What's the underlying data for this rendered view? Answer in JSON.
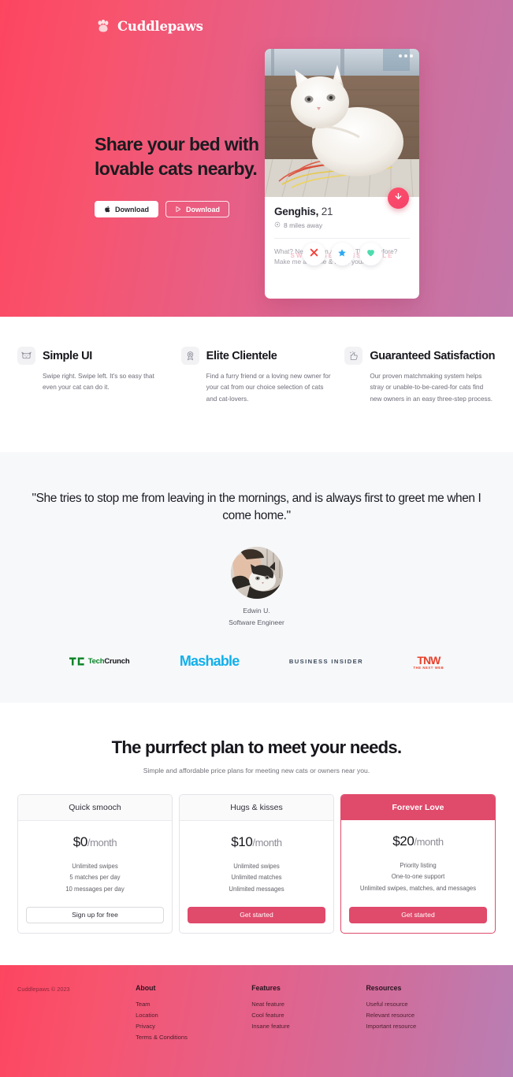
{
  "brand": {
    "name": "Cuddlepaws",
    "logo_icon": "paw-print-icon",
    "accent": "#e04a6b",
    "gradient_start": "#fd4560",
    "gradient_end": "#b87fb4"
  },
  "hero": {
    "headline": "Share your bed with lovable cats nearby.",
    "buttons": [
      {
        "label": "Download",
        "icon": "apple-icon",
        "style": "solid"
      },
      {
        "label": "Download",
        "icon": "google-play-icon",
        "style": "ghost"
      }
    ],
    "card": {
      "photo_alt": "white fluffy cat sitting on windowsill",
      "name": "Genghis,",
      "age": "21",
      "distance": "8 miles away",
      "location_icon": "map-pin-icon",
      "bio_line1": "What? Never seen a cat on Tinder before?",
      "bio_line2": "Make me a meme & I'll be yours",
      "ghost_text": "SWIPE GENGHIS STYLE",
      "download_fab_icon": "download-arrow-icon",
      "actions": [
        {
          "icon": "cross-icon",
          "color": "#f2453d",
          "name": "nope-button"
        },
        {
          "icon": "star-icon",
          "color": "#2aa8f2",
          "name": "superlike-button"
        },
        {
          "icon": "heart-icon",
          "color": "#4ddcae",
          "name": "like-button"
        }
      ]
    }
  },
  "features": [
    {
      "icon": "cat-face-icon",
      "title": "Simple UI",
      "desc": "Swipe right. Swipe left. It's so easy that even your cat can do it."
    },
    {
      "icon": "award-ribbon-icon",
      "title": "Elite Clientele",
      "desc": "Find a furry friend or a loving new owner for your cat from our choice selection of cats and cat-lovers."
    },
    {
      "icon": "thumbs-up-sparkle-icon",
      "title": "Guaranteed Satisfaction",
      "desc": "Our proven matchmaking system helps stray or unable-to-be-cared-for cats find new owners in an easy three-step process."
    }
  ],
  "testimonial": {
    "quote": "\"She tries to stop me from leaving in the mornings, and is always first to greet me when I come home.\"",
    "author_name": "Edwin U.",
    "author_role": "Software Engineer",
    "avatar_alt": "man holding a tuxedo cat"
  },
  "press": [
    {
      "name": "techcrunch-logo",
      "mark": "TC",
      "word_light": "Tech",
      "word_bold": "Crunch",
      "color": "#0a8427"
    },
    {
      "name": "mashable-logo",
      "text": "Mashable",
      "color": "#12b0ea"
    },
    {
      "name": "business-insider-logo",
      "text": "BUSINESS INSIDER",
      "color": "#3c4a5c"
    },
    {
      "name": "tnw-logo",
      "text": "TNW",
      "subtext": "THE NEXT WEB",
      "color": "#e8402b"
    }
  ],
  "pricing": {
    "title": "The purrfect plan to meet your needs.",
    "subtitle": "Simple and affordable price plans for meeting new cats or owners near you.",
    "plans": [
      {
        "name": "Quick smooch",
        "price": "$0",
        "period": "/month",
        "features": [
          "Unlimited swipes",
          "5 matches per day",
          "10 messages per day"
        ],
        "cta": "Sign up for free",
        "featured": false
      },
      {
        "name": "Hugs & kisses",
        "price": "$10",
        "period": "/month",
        "features": [
          "Unlimited swipes",
          "Unlimited matches",
          "Unlimited messages"
        ],
        "cta": "Get started",
        "featured": false
      },
      {
        "name": "Forever Love",
        "price": "$20",
        "period": "/month",
        "features": [
          "Priority listing",
          "One-to-one support",
          "Unlimited swipes, matches, and messages"
        ],
        "cta": "Get started",
        "featured": true
      }
    ]
  },
  "footer": {
    "copyright": "Cuddlepaws © 2023",
    "columns": [
      {
        "heading": "About",
        "links": [
          "Team",
          "Location",
          "Privacy",
          "Terms & Conditions"
        ]
      },
      {
        "heading": "Features",
        "links": [
          "Neat feature",
          "Cool feature",
          "Insane feature"
        ]
      },
      {
        "heading": "Resources",
        "links": [
          "Useful resource",
          "Relevant resource",
          "Important resource"
        ]
      }
    ]
  }
}
